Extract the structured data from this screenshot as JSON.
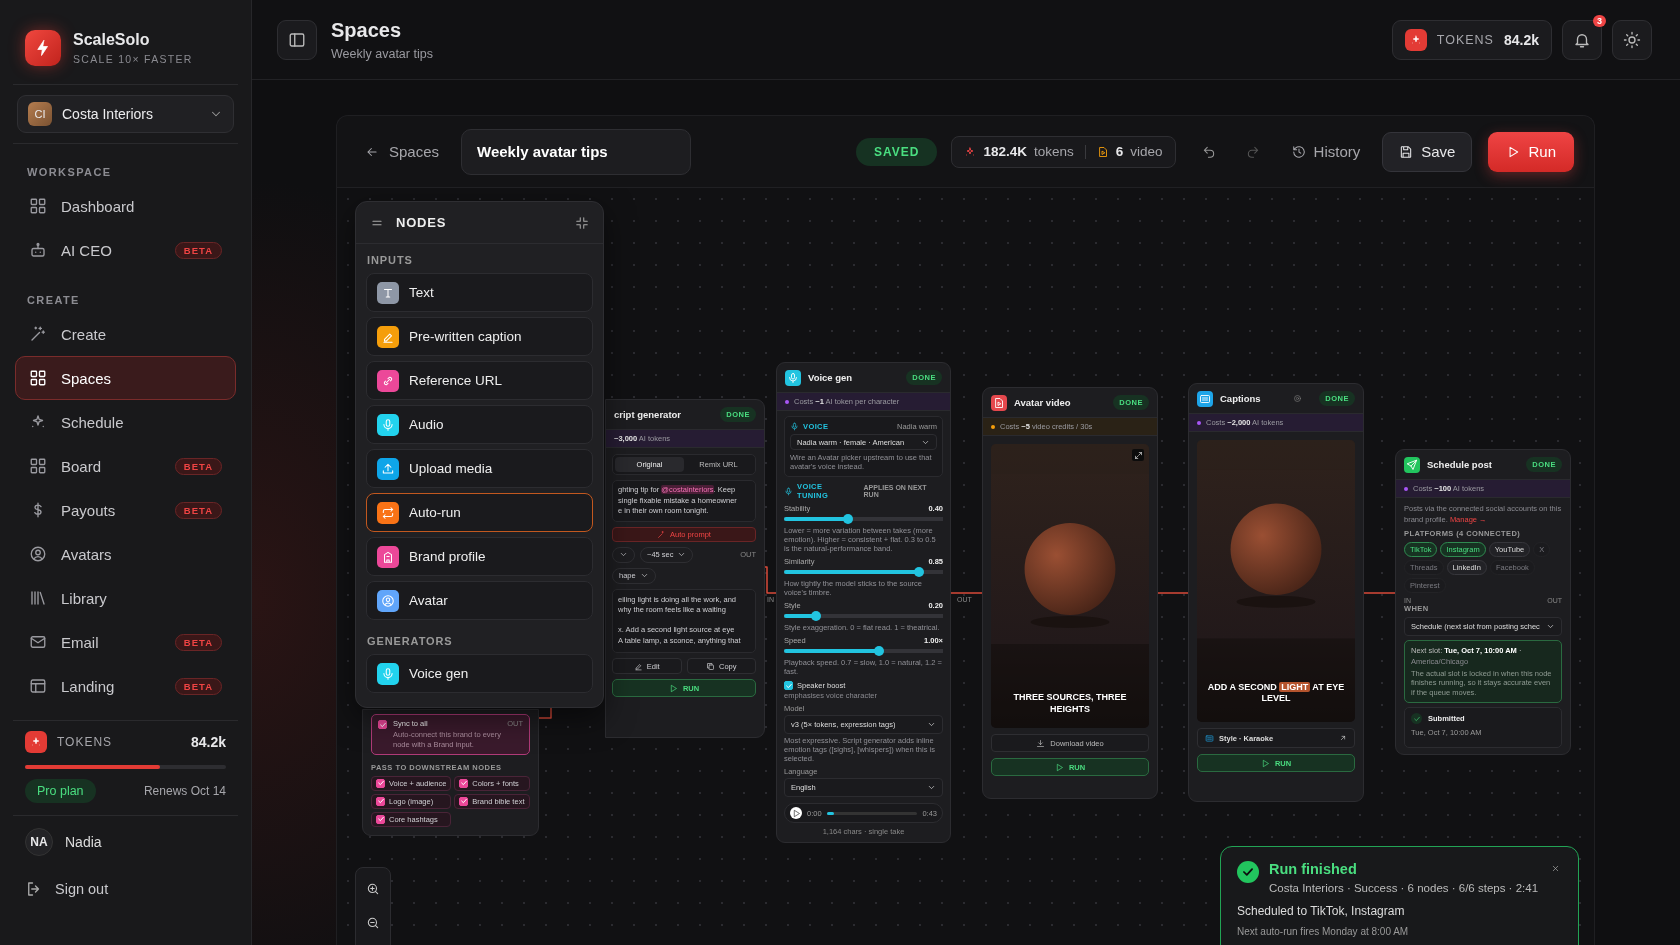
{
  "brand": {
    "name": "ScaleSolo",
    "tagline": "SCALE 10× FASTER"
  },
  "workspace": {
    "initials": "CI",
    "name": "Costa Interiors"
  },
  "nav_sections": [
    {
      "title": "WORKSPACE",
      "items": [
        {
          "label": "Dashboard",
          "selected": false
        },
        {
          "label": "AI CEO",
          "badge": "BETA",
          "selected": false
        }
      ]
    },
    {
      "title": "CREATE",
      "items": [
        {
          "label": "Create",
          "selected": false
        },
        {
          "label": "Spaces",
          "selected": true
        },
        {
          "label": "Schedule",
          "selected": false
        },
        {
          "label": "Board",
          "badge": "BETA",
          "selected": false
        },
        {
          "label": "Payouts",
          "badge": "BETA",
          "selected": false
        },
        {
          "label": "Avatars",
          "selected": false
        },
        {
          "label": "Library",
          "selected": false
        },
        {
          "label": "Email",
          "badge": "BETA",
          "selected": false
        },
        {
          "label": "Landing",
          "badge": "BETA",
          "selected": false
        }
      ]
    }
  ],
  "tokens": {
    "label": "TOKENS",
    "value": "84.2k",
    "level": 0.67,
    "plan": "Pro plan",
    "renews": "Renews Oct 14"
  },
  "user": {
    "initials": "NA",
    "name": "Nadia"
  },
  "sign_out": "Sign out",
  "header": {
    "title": "Spaces",
    "subtitle": "Weekly avatar tips",
    "tokens_label": "TOKENS",
    "tokens_value": "84.2k",
    "notifications": "3"
  },
  "toolbar": {
    "back": "Spaces",
    "name": "Weekly avatar tips",
    "status": "SAVED",
    "tokens": "182.4K",
    "tokens_unit": "tokens",
    "videos": "6",
    "videos_unit": "video",
    "history": "History",
    "save": "Save",
    "run": "Run"
  },
  "node_palette": {
    "title": "NODES",
    "groups": [
      {
        "title": "INPUTS",
        "items": [
          {
            "label": "Text",
            "color": "#8e97a6",
            "selected": false
          },
          {
            "label": "Pre-written caption",
            "color": "#f59e0b",
            "selected": false
          },
          {
            "label": "Reference URL",
            "color": "#ec4899",
            "selected": false
          },
          {
            "label": "Audio",
            "color": "#22d3ee",
            "selected": false
          },
          {
            "label": "Upload media",
            "color": "#0ea5e9",
            "selected": false
          },
          {
            "label": "Auto-run",
            "color": "#f97316",
            "selected": true
          },
          {
            "label": "Brand profile",
            "color": "#ec4899",
            "selected": false
          },
          {
            "label": "Avatar",
            "color": "#60a5fa",
            "selected": false
          }
        ]
      },
      {
        "title": "GENERATORS",
        "items": [
          {
            "label": "Voice gen",
            "color": "#22d3ee",
            "selected": false
          }
        ]
      }
    ]
  },
  "script_node": {
    "title": "cript generator",
    "status": "DONE",
    "cost": "**~3,000** AI tokens",
    "tabs": [
      {
        "label": "Original",
        "selected": true
      },
      {
        "label": "Remix URL",
        "selected": false
      }
    ],
    "prompt_lines": [
      "ghting tip for **@costainteriors**. Keep",
      "single fixable mistake a homeowner",
      "e in their own room tonight."
    ],
    "auto_prompt": "Auto prompt",
    "length": "~45 sec",
    "shape": "hape",
    "script_paragraphs": [
      [
        "eiling light is doing all the work, and",
        "why the room feels like a waiting"
      ],
      [
        "x. Add a second light source at eye",
        "A table lamp, a sconce, anything that"
      ]
    ],
    "edit": "Edit",
    "copy": "Copy",
    "run": "RUN",
    "out": "OUT"
  },
  "brand_node": {
    "sync_label": "Sync to all",
    "sync_checked": true,
    "sync_hint": "Auto-connect this brand to every node with a Brand input.",
    "out": "OUT",
    "pass_label": "PASS TO DOWNSTREAM NODES",
    "passes": [
      {
        "label": "Voice + audience",
        "checked": true
      },
      {
        "label": "Colors + fonts",
        "checked": true
      },
      {
        "label": "Logo (image)",
        "checked": true
      },
      {
        "label": "Brand bible text",
        "checked": true
      },
      {
        "label": "Core hashtags",
        "checked": true
      }
    ]
  },
  "voice_node": {
    "title": "Voice gen",
    "status": "DONE",
    "cost": "Costs **~1** AI token per character",
    "voice_label": "VOICE",
    "voice_current": "Nadia warm",
    "voice_select": "Nadia warm · female · American",
    "voice_hint": "Wire an Avatar picker upstream to use that avatar's voice instead.",
    "tuning_label": "VOICE TUNING",
    "tuning_note": "APPLIES ON NEXT RUN",
    "sliders": [
      {
        "label": "Stability",
        "value": "0.40",
        "level": 0.4,
        "hint": "Lower = more variation between takes (more emotion). Higher = consistent + flat. 0.3 to 0.5 is the natural-performance band."
      },
      {
        "label": "Similarity",
        "value": "0.85",
        "level": 0.85,
        "hint": "How tightly the model sticks to the source voice's timbre."
      },
      {
        "label": "Style",
        "value": "0.20",
        "level": 0.2,
        "hint": "Style exaggeration. 0 = flat read. 1 = theatrical."
      },
      {
        "label": "Speed",
        "value": "1.00×",
        "level": 0.6,
        "hint": "Playback speed. 0.7 = slow, 1.0 = natural, 1.2 = fast."
      }
    ],
    "boost": {
      "label": "Speaker boost",
      "checked": true,
      "note": "emphasises voice character"
    },
    "model_label": "Model",
    "model": "v3 (5× tokens, expression tags)",
    "model_hint": "Most expressive. Script generator adds inline emotion tags ([sighs], [whispers]) when this is selected.",
    "language_label": "Language",
    "language": "English",
    "player": {
      "start": "0:00",
      "end": "0:43",
      "level": 0.08
    },
    "footer": "1,164 chars · single take",
    "in": "IN",
    "out": "OUT"
  },
  "avatar_node": {
    "title": "Avatar video",
    "status": "DONE",
    "cost": "Costs **~5** video credits / 30s",
    "caption": "THREE SOURCES, THREE HEIGHTS",
    "download": "Download video",
    "run": "RUN"
  },
  "captions_node": {
    "title": "Captions",
    "status": "DONE",
    "cost": "Costs **~2,000** AI tokens",
    "caption": "ADD A SECOND **LIGHT** AT EYE LEVEL",
    "style": "Style · Karaoke",
    "run": "RUN"
  },
  "schedule_node": {
    "title": "Schedule post",
    "status": "DONE",
    "cost": "Costs **~100** AI tokens",
    "note": "Posts via the connected social accounts on this brand profile.",
    "manage": "Manage →",
    "platforms_label": "PLATFORMS (4 CONNECTED)",
    "platforms": [
      {
        "label": "TikTok",
        "selected": true,
        "connected": true
      },
      {
        "label": "Instagram",
        "selected": true,
        "connected": true
      },
      {
        "label": "YouTube",
        "selected": false,
        "connected": true
      },
      {
        "label": "X",
        "selected": false,
        "connected": false
      },
      {
        "label": "Threads",
        "selected": false,
        "connected": false
      },
      {
        "label": "LinkedIn",
        "selected": false,
        "connected": true
      },
      {
        "label": "Facebook",
        "selected": false,
        "connected": false
      },
      {
        "label": "Pinterest",
        "selected": false,
        "connected": false
      }
    ],
    "in": "IN",
    "out": "OUT",
    "when_label": "WHEN",
    "when": "Schedule (next slot from posting schec",
    "slot": "Next slot: **Tue, Oct 7, 10:00 AM** ·",
    "slot_tz": "America/Chicago",
    "slot_note": "The actual slot is locked in when this node finishes running, so it stays accurate even if the queue moves.",
    "submitted": "Submitted",
    "submitted_time": "Tue, Oct 7, 10:00 AM"
  },
  "toast": {
    "title": "Run finished",
    "meta": "Costa Interiors · Success · 6 nodes · 6/6 steps · 2:41",
    "body": "Scheduled to TikTok, Instagram",
    "next": "Next auto-run fires Monday at 8:00 AM"
  }
}
